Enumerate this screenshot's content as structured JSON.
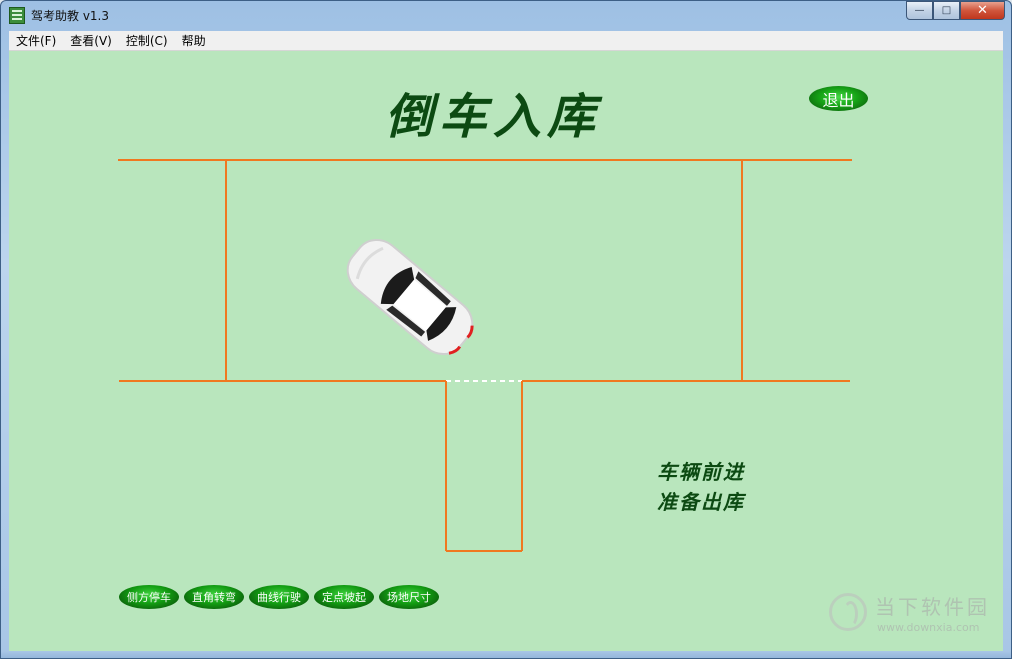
{
  "window": {
    "title": "驾考助教 v1.3",
    "controls": {
      "minimize": "—",
      "maximize": "□",
      "close": "✕"
    }
  },
  "menu": [
    {
      "label": "文件(F)"
    },
    {
      "label": "查看(V)"
    },
    {
      "label": "控制(C)"
    },
    {
      "label": "帮助"
    }
  ],
  "scene": {
    "heading": "倒车入库",
    "exit_label": "退出",
    "hint_line1": "车辆前进",
    "hint_line2": "准备出库",
    "line_color": "#f07820",
    "background_color": "#b9e6bd",
    "text_color": "#0c4a12"
  },
  "nav_buttons": [
    {
      "label": "侧方停车"
    },
    {
      "label": "直角转弯"
    },
    {
      "label": "曲线行驶"
    },
    {
      "label": "定点坡起"
    },
    {
      "label": "场地尺寸"
    }
  ],
  "watermark": {
    "title": "当下软件园",
    "url": "www.downxia.com"
  }
}
